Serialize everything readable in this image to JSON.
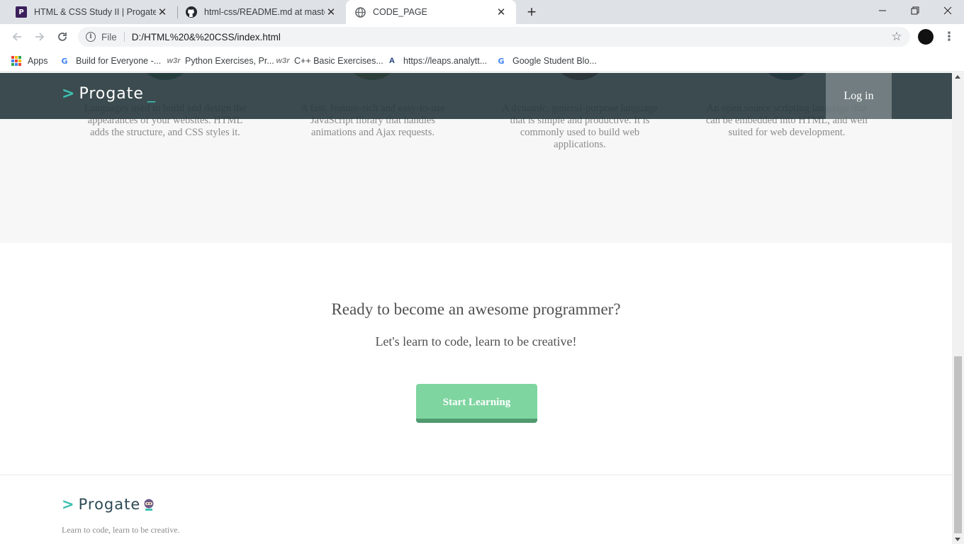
{
  "browser": {
    "tabs": [
      {
        "title": "HTML & CSS Study II | Progate - P",
        "favicon": "progate-icon",
        "fav_text": "P"
      },
      {
        "title": "html-css/README.md at master ·",
        "favicon": "github-icon"
      },
      {
        "title": "CODE_PAGE",
        "favicon": "globe-icon",
        "active": true
      }
    ],
    "new_tab_symbol": "+",
    "address": {
      "scheme_label": "File",
      "url": "D:/HTML%20&%20CSS/index.html"
    },
    "bookmarks": [
      {
        "label": "Apps",
        "icon": "apps-grid-icon"
      },
      {
        "label": "Build for Everyone -...",
        "icon": "google-icon"
      },
      {
        "label": "Python Exercises, Pr...",
        "icon": "w3resource-icon"
      },
      {
        "label": "C++ Basic Exercises...",
        "icon": "w3resource-icon"
      },
      {
        "label": "https://leaps.analytt...",
        "icon": "leaps-icon"
      },
      {
        "label": "Google Student Blo...",
        "icon": "google-icon"
      }
    ]
  },
  "page": {
    "header": {
      "logo_text": "Progate",
      "login_label": "Log in"
    },
    "lessons": [
      {
        "text": "Languages used to build and design the appearances of your websites. HTML adds the structure, and CSS styles it.",
        "color": "#2e6f55"
      },
      {
        "text": "A fast, feature-rich and easy-to-use JavaScript library that handles animations and Ajax requests.",
        "color": "#6a7a2a"
      },
      {
        "text": "A dynamic, general-purpose language that is simple and productive. It is commonly used to build web applications.",
        "color": "#6b2a2a"
      },
      {
        "text": "An open source scripting language that can be embedded into HTML, and well suited for web development.",
        "color": "#2a4a6a"
      }
    ],
    "cta": {
      "title": "Ready to become an awesome programmer?",
      "subtitle": "Let's learn to code, learn to be creative!",
      "button_label": "Start Learning",
      "button_color": "#7fd5a0"
    },
    "footer": {
      "logo_text": "Progate",
      "tagline": "Learn to code, learn to be creative."
    }
  }
}
